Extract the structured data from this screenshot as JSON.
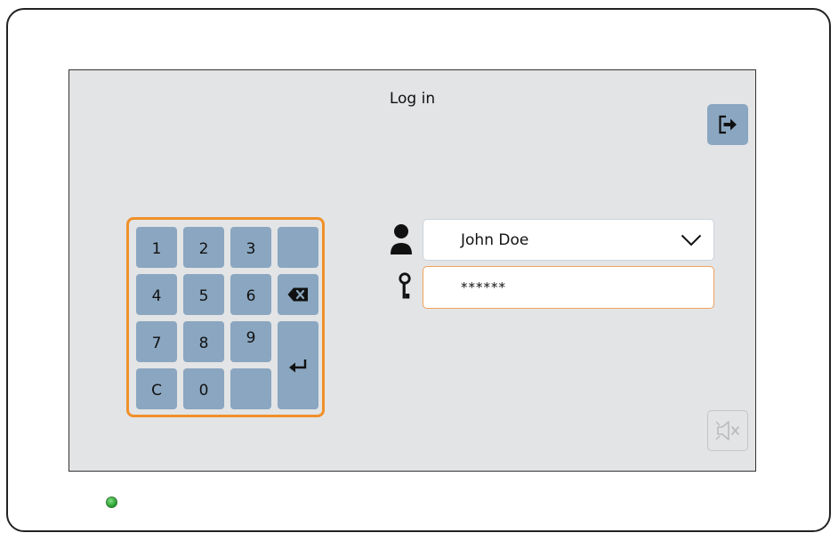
{
  "screen": {
    "title": "Log in"
  },
  "keypad": {
    "keys": [
      {
        "label": "1",
        "icon": null
      },
      {
        "label": "2",
        "icon": null
      },
      {
        "label": "3",
        "icon": null
      },
      {
        "label": "",
        "icon": null
      },
      {
        "label": "4",
        "icon": null
      },
      {
        "label": "5",
        "icon": null
      },
      {
        "label": "6",
        "icon": null
      },
      {
        "label": "",
        "icon": "backspace-icon"
      },
      {
        "label": "7",
        "icon": null
      },
      {
        "label": "8",
        "icon": null
      },
      {
        "label": "9",
        "icon": null
      },
      {
        "label": "",
        "icon": "enter-icon"
      },
      {
        "label": "C",
        "icon": null
      },
      {
        "label": "0",
        "icon": null
      },
      {
        "label": "",
        "icon": null
      }
    ],
    "accent_color": "#f0902a",
    "key_color": "#8aa6c0"
  },
  "login": {
    "user_icon": "user-icon",
    "username_value": "John Doe",
    "key_icon": "key-icon",
    "password_value": "******"
  },
  "buttons": {
    "logout_icon": "logout-icon",
    "mute_icon": "speaker-muted-icon"
  },
  "status": {
    "led_color": "#2fb23a"
  }
}
